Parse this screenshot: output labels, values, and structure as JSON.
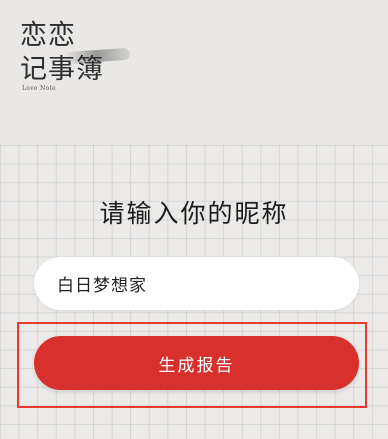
{
  "logo": {
    "line1": "恋恋",
    "line2": "记事簿",
    "subtitle": "Love Note"
  },
  "prompt": {
    "title": "请输入你的昵称"
  },
  "nickname_input": {
    "value": "白日梦想家"
  },
  "generate_button": {
    "label": "生成报告"
  },
  "colors": {
    "accent": "#d8302d",
    "highlight_border": "#e8392c",
    "background": "#e9e8e6"
  }
}
